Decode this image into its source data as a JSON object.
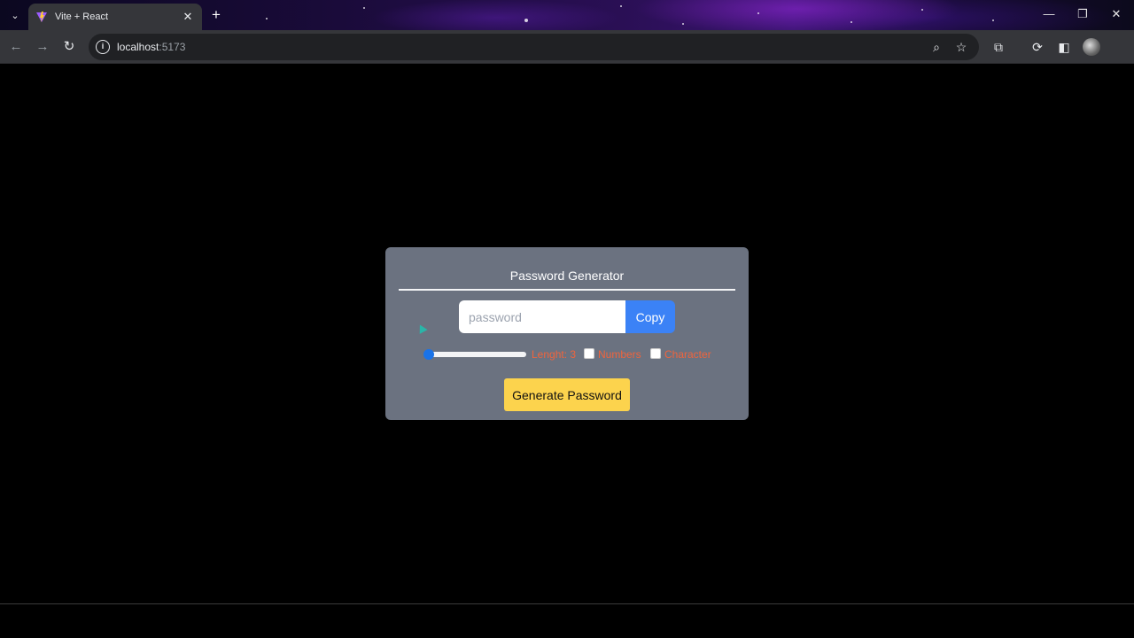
{
  "browser": {
    "tab_title": "Vite + React",
    "url_host": "localhost",
    "url_port": ":5173",
    "icons": {
      "tab_search": "chevron-down-icon",
      "tab_close": "close-icon",
      "new_tab": "plus-icon",
      "back": "arrow-left-icon",
      "forward": "arrow-right-icon",
      "reload": "reload-icon",
      "site_info": "info-icon",
      "zoom": "zoom-icon",
      "bookmark": "star-icon",
      "extensions": "puzzle-icon",
      "sync": "sync-icon",
      "side_panel": "side-panel-icon",
      "minimize": "minimize-icon",
      "maximize": "maximize-icon",
      "close_window": "close-icon"
    },
    "glyphs": {
      "tab_search": "⌄",
      "tab_close": "✕",
      "new_tab": "+",
      "back": "←",
      "forward": "→",
      "reload": "↻",
      "site_info": "i",
      "zoom": "⌕",
      "bookmark": "☆",
      "extensions": "⧉",
      "sync": "⟳",
      "side_panel": "◧",
      "minimize": "—",
      "maximize": "❐",
      "close_window": "✕"
    }
  },
  "app": {
    "title": "Password Generator",
    "password_placeholder": "password",
    "password_value": "",
    "copy_label": "Copy",
    "length_label": "Lenght: 3",
    "length_value": 3,
    "numbers_label": "Numbers",
    "numbers_checked": false,
    "character_label": "Character",
    "character_checked": false,
    "generate_label": "Generate Password"
  },
  "colors": {
    "card_bg": "#6b7280",
    "copy_bg": "#3b82f6",
    "generate_bg": "#fcd34d",
    "option_text": "#f0643c",
    "slider_thumb": "#1a73e8"
  }
}
